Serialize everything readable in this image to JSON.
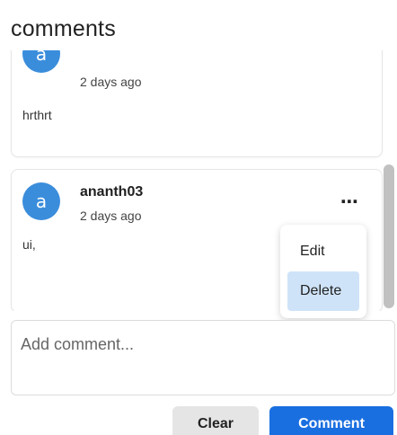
{
  "header": {
    "title": "comments"
  },
  "comments": [
    {
      "avatar_letter": "a",
      "username": "",
      "time": "2 days ago",
      "body": "hrthrt"
    },
    {
      "avatar_letter": "a",
      "username": "ananth03",
      "time": "2 days ago",
      "body": "ui,"
    }
  ],
  "more_icon": "⋯",
  "menu": {
    "items": [
      {
        "label": "Edit"
      },
      {
        "label": "Delete"
      }
    ],
    "active": "Delete"
  },
  "composer": {
    "placeholder": "Add comment...",
    "clear_label": "Clear",
    "submit_label": "Comment"
  },
  "colors": {
    "accent": "#1a6fe0",
    "avatar": "#3a8ddb",
    "menu_highlight": "#cfe3f8"
  }
}
